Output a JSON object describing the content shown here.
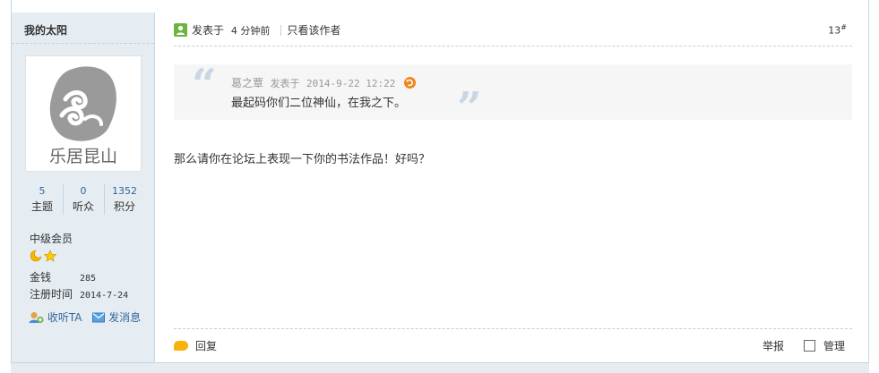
{
  "author": {
    "name": "我的太阳",
    "avatar_text": "乐居昆山",
    "stats": [
      {
        "value": "5",
        "label": "主题"
      },
      {
        "value": "0",
        "label": "听众"
      },
      {
        "value": "1352",
        "label": "积分"
      }
    ],
    "level": "中级会员",
    "money_label": "金钱",
    "money_value": "285",
    "reg_label": "注册时间",
    "reg_value": "2014-7-24",
    "follow_label": "收听TA",
    "message_label": "发消息"
  },
  "post": {
    "posted_label": "发表于",
    "posted_time": "4 分钟前",
    "only_author_label": "只看该作者",
    "floor": "13",
    "floor_sup": "#",
    "quote": {
      "author": "葛之覃",
      "posted_label": "发表于",
      "time": "2014-9-22 12:22",
      "text": "最起码你们二位神仙，在我之下。"
    },
    "body": "那么请你在论坛上表现一下你的书法作品！好吗？",
    "reply_label": "回复",
    "report_label": "举报",
    "manage_label": "管理"
  },
  "colors": {
    "sidebar_bg": "#e5edf2",
    "border": "#c2d5e3",
    "link_blue": "#336699",
    "posted_icon_green": "#6db33f",
    "reply_icon_orange": "#f8b20c"
  }
}
